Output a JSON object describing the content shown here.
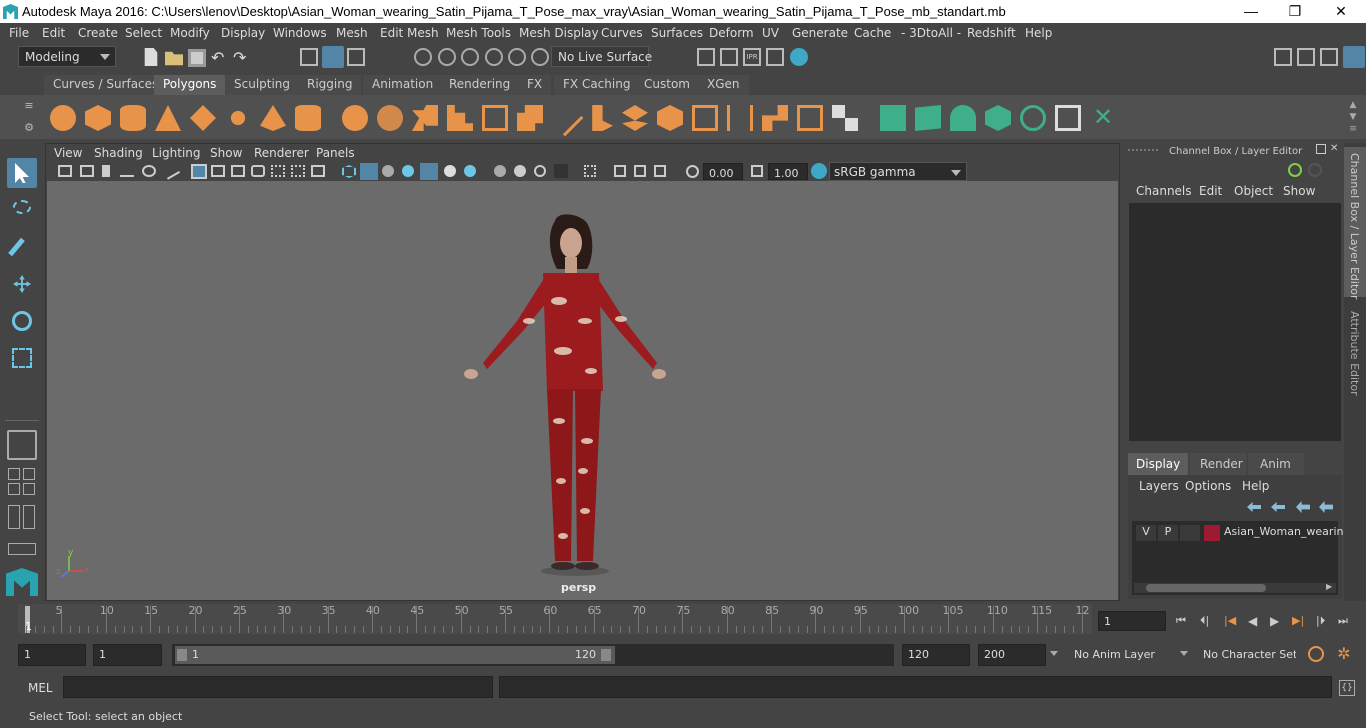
{
  "window": {
    "title": "Autodesk Maya 2016: C:\\Users\\lenov\\Desktop\\Asian_Woman_wearing_Satin_Pijama_T_Pose_max_vray\\Asian_Woman_wearing_Satin_Pijama_T_Pose_mb_standart.mb",
    "minimize": "—",
    "restore": "❐",
    "close": "✕"
  },
  "menu": [
    "File",
    "Edit",
    "Create",
    "Select",
    "Modify",
    "Display",
    "Windows",
    "Mesh",
    "Edit Mesh",
    "Mesh Tools",
    "Mesh Display",
    "Curves",
    "Surfaces",
    "Deform",
    "UV",
    "Generate",
    "Cache",
    "- 3DtoAll -",
    "Redshift",
    "Help"
  ],
  "status": {
    "mode": "Modeling",
    "live_surface": "No Live Surface"
  },
  "shelf_tabs": [
    "Curves / Surfaces",
    "Polygons",
    "Sculpting",
    "Rigging",
    "Animation",
    "Rendering",
    "FX",
    "FX Caching",
    "Custom",
    "XGen"
  ],
  "shelf_active": "Polygons",
  "viewport": {
    "menu": [
      "View",
      "Shading",
      "Lighting",
      "Show",
      "Renderer",
      "Panels"
    ],
    "exposure": "0.00",
    "gamma": "1.00",
    "colorspace": "sRGB gamma",
    "camera": "persp",
    "axis_x": "x",
    "axis_y": "y",
    "axis_z": "z"
  },
  "channel_box": {
    "title": "Channel Box / Layer Editor",
    "menu": [
      "Channels",
      "Edit",
      "Object",
      "Show"
    ],
    "layer_tabs": [
      "Display",
      "Render",
      "Anim"
    ],
    "layer_menu": [
      "Layers",
      "Options",
      "Help"
    ],
    "layer": {
      "v": "V",
      "p": "P",
      "name": "Asian_Woman_wearin",
      "color": "#9b1b30"
    }
  },
  "side_tabs": [
    "Channel Box / Layer Editor",
    "Attribute Editor"
  ],
  "timeline": {
    "ticks": [
      "5",
      "10",
      "15",
      "20",
      "25",
      "30",
      "35",
      "40",
      "45",
      "50",
      "55",
      "60",
      "65",
      "70",
      "75",
      "80",
      "85",
      "90",
      "95",
      "100",
      "105",
      "110",
      "115",
      "12"
    ],
    "current_marker": "1",
    "current_frame": "1"
  },
  "range": {
    "start": "1",
    "start2": "1",
    "slider_start": "1",
    "slider_end": "120",
    "end": "120",
    "end2": "200",
    "anim_layer": "No Anim Layer",
    "char_set": "No Character Set"
  },
  "command": {
    "lang": "MEL"
  },
  "help_line": "Select Tool: select an object",
  "colors": {
    "accent_orange": "#e8934a",
    "accent_green": "#3fae8a",
    "active_blue": "#5285a6"
  }
}
